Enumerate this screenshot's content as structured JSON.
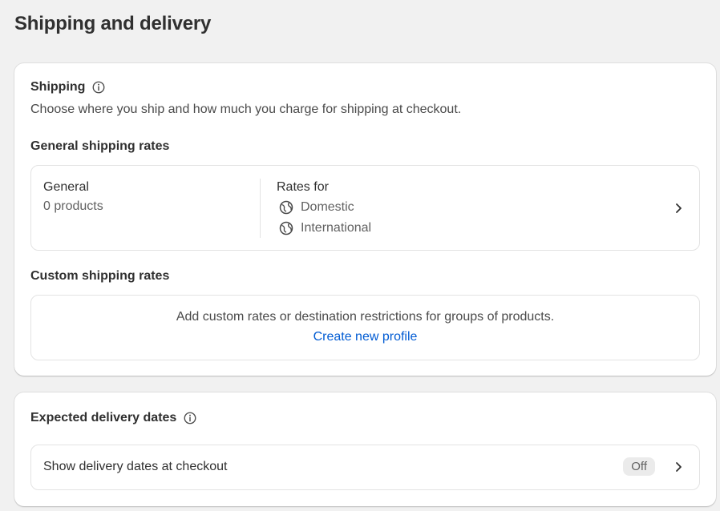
{
  "page": {
    "title": "Shipping and delivery"
  },
  "shipping": {
    "heading": "Shipping",
    "description": "Choose where you ship and how much you charge for shipping at checkout.",
    "general_heading": "General shipping rates",
    "general_profile": {
      "name": "General",
      "products": "0 products",
      "rates_for_label": "Rates for",
      "zones": [
        "Domestic",
        "International"
      ]
    },
    "custom_heading": "Custom shipping rates",
    "custom_text": "Add custom rates or destination restrictions for groups of products.",
    "custom_link": "Create new profile"
  },
  "delivery": {
    "heading": "Expected delivery dates",
    "row_label": "Show delivery dates at checkout",
    "status": "Off"
  },
  "icons": {
    "info": "info-circle-icon",
    "globe": "globe-icon",
    "chevron": "chevron-right-icon"
  },
  "colors": {
    "background": "#f1f1f1",
    "card": "#ffffff",
    "link": "#005bd3",
    "badge_bg": "#ebebeb"
  }
}
